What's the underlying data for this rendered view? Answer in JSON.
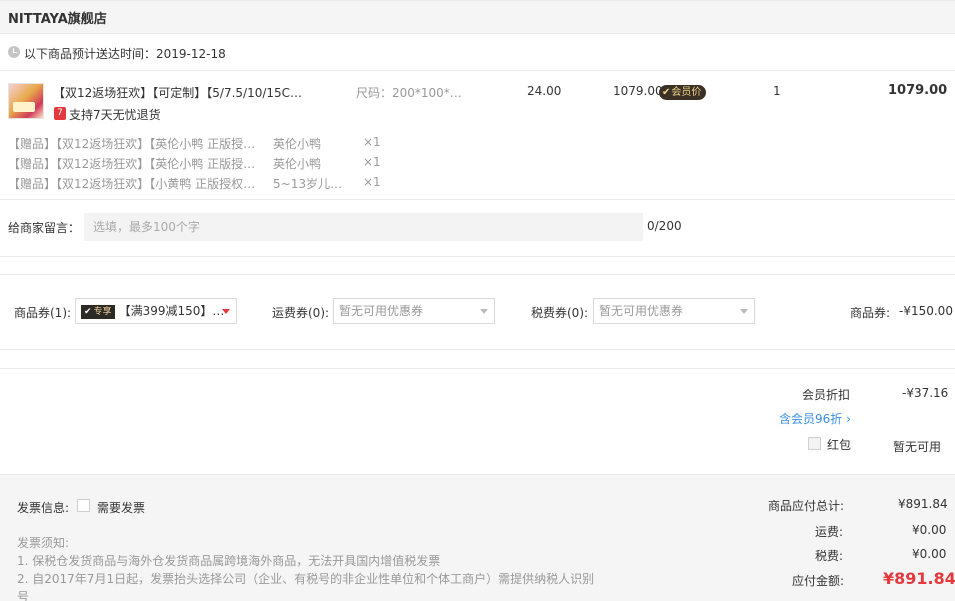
{
  "store": {
    "name": "NITTAYA旗舰店"
  },
  "delivery": {
    "text": "以下商品预计送达时间：2019-12-18"
  },
  "product": {
    "title": "【双12返场狂欢】【可定制】【5/7.5/10/15C…",
    "spec": "尺码：200*100*…",
    "original_price": "24.00",
    "price": "1079.00",
    "vip_tag": "会员价",
    "quantity": "1",
    "subtotal": "1079.00",
    "return_badge": "7",
    "return_text": "支持7天无忧退货"
  },
  "gifts": [
    {
      "title": "【赠品】【双12返场狂欢】【英伦小鸭 正版授…",
      "spec": "英伦小鸭",
      "qty": "×1"
    },
    {
      "title": "【赠品】【双12返场狂欢】【英伦小鸭 正版授…",
      "spec": "英伦小鸭",
      "qty": "×1"
    },
    {
      "title": "【赠品】【双12返场狂欢】【小黄鸭 正版授权…",
      "spec": "5~13岁儿…",
      "qty": "×1"
    }
  ],
  "message": {
    "label": "给商家留言：",
    "placeholder": "选填，最多100个字",
    "counter": "0/200"
  },
  "coupons": {
    "goods_label": "商品券(1):",
    "goods_badge": "专享",
    "goods_value": "【满399减150】…",
    "shipping_label": "运费券(0):",
    "shipping_value": "暂无可用优惠券",
    "tax_label": "税费券(0):",
    "tax_value": "暂无可用优惠券",
    "discount_label": "商品券:",
    "discount_value": "-¥150.00"
  },
  "member": {
    "discount_label": "会员折扣",
    "discount_value": "-¥37.16",
    "link": "含会员96折 ›",
    "redpacket_label": "红包",
    "redpacket_value": "暂无可用"
  },
  "invoice": {
    "label": "发票信息:",
    "checkbox_label": "需要发票",
    "notice_title": "发票须知:",
    "notice_1": "1. 保税仓发货商品与海外仓发货商品属跨境海外商品，无法开具国内增值税发票",
    "notice_2a": "2. 自2017年7月1日起，发票抬头选择公司（企业、有税号的非企业性单位和个体工商户）需提供纳税人识别",
    "notice_2b": "号"
  },
  "summary": {
    "goods_total_label": "商品应付总计:",
    "goods_total_value": "¥891.84",
    "shipping_label": "运费:",
    "shipping_value": "¥0.00",
    "tax_label": "税费:",
    "tax_value": "¥0.00",
    "payable_label": "应付金额:",
    "payable_value": "¥891.84"
  },
  "colors": {
    "accent_red": "#e4393c",
    "link_blue": "#3a8ee6",
    "vip_dark": "#3b3026"
  }
}
